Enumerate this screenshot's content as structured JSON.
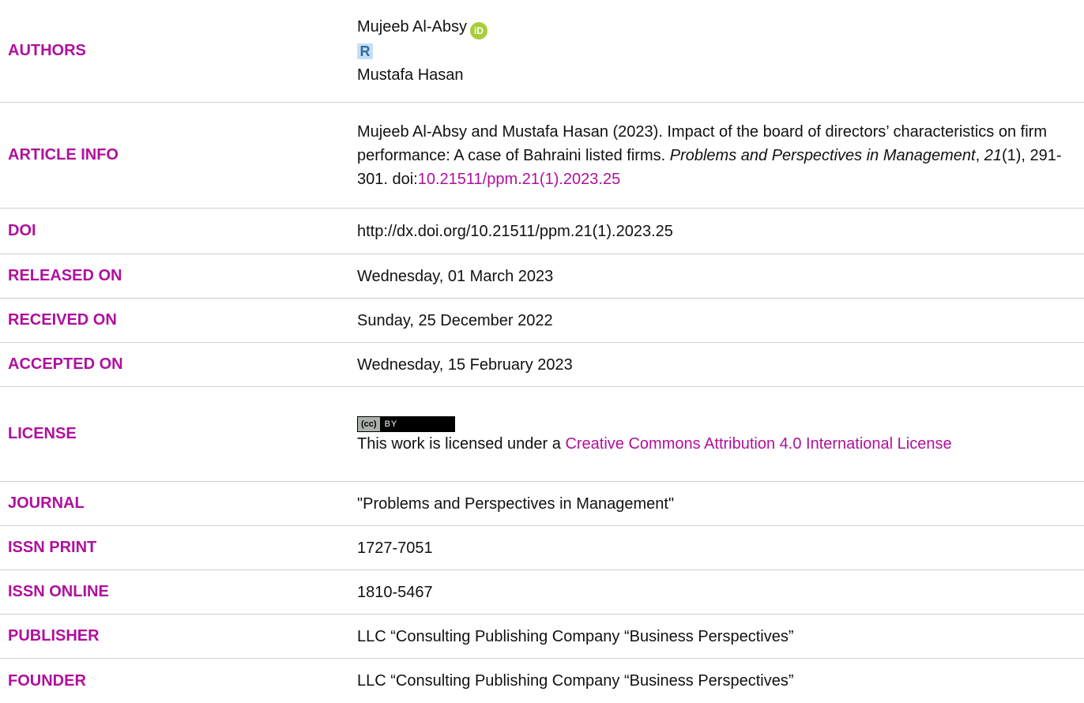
{
  "rows": {
    "authors": {
      "label": "AUTHORS",
      "author1": "Mujeeb Al-Absy",
      "orcid_icon": "iD",
      "rg_icon": "R",
      "author2": "Mustafa Hasan"
    },
    "article_info": {
      "label": "ARTICLE INFO",
      "text1": "Mujeeb Al-Absy and Mustafa Hasan (2023). Impact of the board of directors’ characteristics on firm performance: A case of Bahraini listed firms. ",
      "journal_italic": "Problems and Perspectives in Management",
      "sep1": ", ",
      "volume_italic": "21",
      "text2": "(1), 291-301. doi:",
      "doi_link": "10.21511/ppm.21(1).2023.25"
    },
    "doi": {
      "label": "DOI",
      "value": "http://dx.doi.org/10.21511/ppm.21(1).2023.25"
    },
    "released": {
      "label": "RELEASED ON",
      "value": "Wednesday, 01 March 2023"
    },
    "received": {
      "label": "RECEIVED ON",
      "value": "Sunday, 25 December 2022"
    },
    "accepted": {
      "label": "ACCEPTED ON",
      "value": "Wednesday, 15 February 2023"
    },
    "license": {
      "label": "LICENSE",
      "badge_cc": "(cc)",
      "badge_by": "BY",
      "text": "This work is licensed under a ",
      "link": "Creative Commons Attribution 4.0 International License"
    },
    "journal": {
      "label": "JOURNAL",
      "value": "\"Problems and Perspectives in Management\""
    },
    "issn_print": {
      "label": "ISSN PRINT",
      "value": "1727-7051"
    },
    "issn_online": {
      "label": "ISSN ONLINE",
      "value": "1810-5467"
    },
    "publisher": {
      "label": "PUBLISHER",
      "value": "LLC “Consulting Publishing Company “Business Perspectives”"
    },
    "founder": {
      "label": "FOUNDER",
      "value": "LLC “Consulting Publishing Company “Business Perspectives”"
    }
  },
  "colors": {
    "label": "#b0109c",
    "link": "#b0109c",
    "orcid": "#a6ce39"
  }
}
